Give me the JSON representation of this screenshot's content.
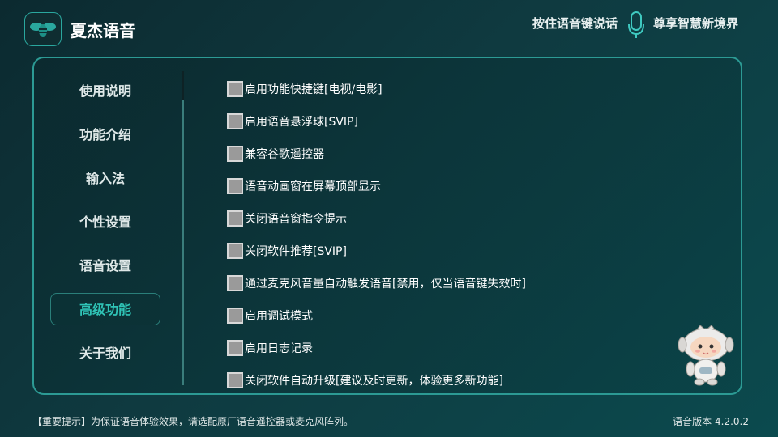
{
  "app": {
    "title": "夏杰语音",
    "logo_icon": "bee-logo-icon"
  },
  "header": {
    "hint": "按住语音键说话",
    "mic_icon": "microphone-icon",
    "slogan": "尊享智慧新境界"
  },
  "sidebar": {
    "active_index": 5,
    "items": [
      {
        "label": "使用说明"
      },
      {
        "label": "功能介绍"
      },
      {
        "label": "输入法"
      },
      {
        "label": "个性设置"
      },
      {
        "label": "语音设置"
      },
      {
        "label": "高级功能"
      },
      {
        "label": "关于我们"
      }
    ]
  },
  "options": [
    {
      "label": "启用功能快捷键[电视/电影]",
      "checked": false
    },
    {
      "label": "启用语音悬浮球[SVIP]",
      "checked": false
    },
    {
      "label": "兼容谷歌遥控器",
      "checked": false
    },
    {
      "label": "语音动画窗在屏幕顶部显示",
      "checked": false
    },
    {
      "label": "关闭语音窗指令提示",
      "checked": false
    },
    {
      "label": "关闭软件推荐[SVIP]",
      "checked": false
    },
    {
      "label": "通过麦克风音量自动触发语音[禁用，仅当语音键失效时]",
      "checked": false
    },
    {
      "label": "启用调试模式",
      "checked": false
    },
    {
      "label": "启用日志记录",
      "checked": false
    },
    {
      "label": "关闭软件自动升级[建议及时更新，体验更多新功能]",
      "checked": false
    }
  ],
  "mascot_icon": "robot-mascot-icon",
  "footer": {
    "tip": "【重要提示】为保证语音体验效果，请选配原厂语音遥控器或麦克风阵列。",
    "version_label": "语音版本",
    "version": "4.2.0.2"
  },
  "colors": {
    "accent": "#2fc3b6",
    "border": "#2c9a94",
    "background": "#0f3a40"
  }
}
